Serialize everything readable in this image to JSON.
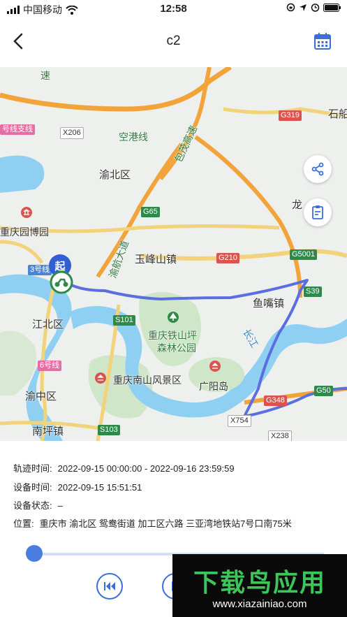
{
  "status_bar": {
    "carrier": "中国移动",
    "time": "12:58"
  },
  "header": {
    "title": "c2",
    "back_icon": "chevron-left-icon",
    "calendar_icon": "calendar-icon"
  },
  "map": {
    "labels": {
      "yubei": "渝北区",
      "yufeng": "玉峰山镇",
      "jiangbei": "江北区",
      "yuzhong": "渝中区",
      "nanping": "南坪镇",
      "museum": "重庆园博园",
      "tieshan": "重庆铁山坪",
      "forest_park": "森林公园",
      "nanshan": "重庆南山风景区",
      "guangyang": "广阳岛",
      "yuzui": "鱼嘴镇",
      "kong_gang": "空港线",
      "bao_mao": "包茂高速",
      "yu_hang": "渝航大道",
      "chang_jiang": "长江",
      "shi_chuan": "石船",
      "long": "龙",
      "speed": "速",
      "line3": "3号线",
      "line6": "6号线",
      "line9": "号线支线"
    },
    "road_tags": {
      "g319": "G319",
      "g65": "G65",
      "g210": "G210",
      "g5001": "G5001",
      "s39": "S39",
      "s101": "S101",
      "s103": "S103",
      "g348": "G348",
      "g50": "G50",
      "x206": "X206",
      "x754": "X754",
      "x238": "X238"
    },
    "start_marker": "起",
    "share_icon": "share-icon",
    "report_icon": "report-icon"
  },
  "info": {
    "track_time_label": "轨迹时间:",
    "track_time_value": "2022-09-15 00:00:00 - 2022-09-16 23:59:59",
    "device_time_label": "设备时间:",
    "device_time_value": "2022-09-15 15:51:51",
    "device_status_label": "设备状态:",
    "device_status_value": "–",
    "location_label": "位置:",
    "location_value": "重庆市 渝北区 鸳鸯街道 加工区六路 三亚湾地铁站7号口南75米"
  },
  "controls": {
    "rewind_icon": "rewind-icon",
    "play_icon": "play-icon"
  },
  "watermark": {
    "title": "下载鸟应用",
    "url": "www.xiazainiao.com"
  },
  "colors": {
    "accent": "#3a6fd8",
    "route": "#5b6ee0",
    "highway": "#f2a33a"
  }
}
